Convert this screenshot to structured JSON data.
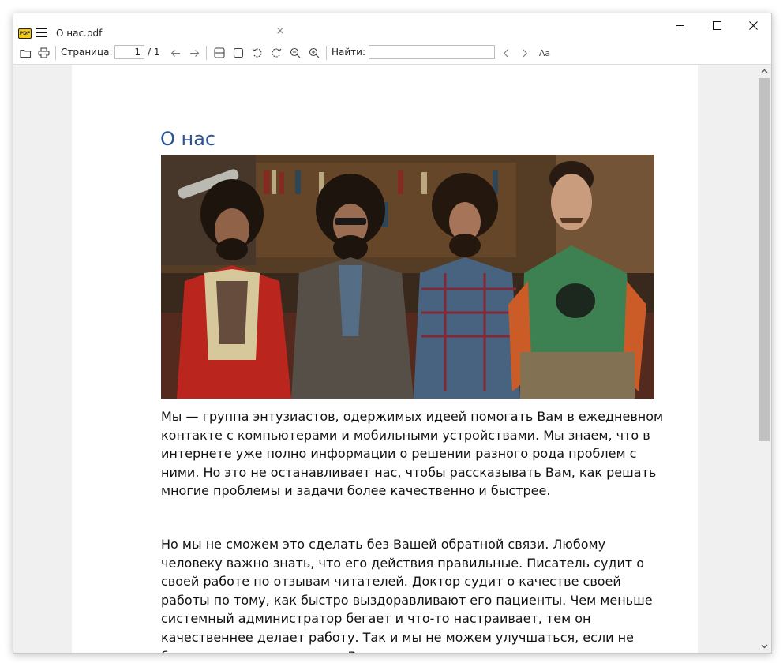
{
  "window": {
    "tab_title": "О нас.pdf",
    "tab_close": "×",
    "app_logo": "PDF"
  },
  "toolbar": {
    "page_label": "Страница:",
    "page_current": "1",
    "page_total": "/ 1",
    "find_label": "Найти:",
    "find_value": "",
    "match_case": "Aa"
  },
  "document": {
    "heading": "О нас",
    "paragraph1": "Мы — группа энтузиастов, одержимых идеей помогать Вам в ежедневном контакте с компьютерами и мобильными устройствами. Мы знаем, что в интернете уже полно информации о решении разного рода проблем с ними. Но это не останавливает нас, чтобы рассказывать Вам, как решать многие проблемы и задачи более качественно и быстрее.",
    "paragraph2": "Но мы не сможем это сделать без Вашей обратной связи. Любому человеку важно знать, что его действия правильные. Писатель судит о своей работе по отзывам читателей. Доктор судит о качестве своей работы по тому, как быстро выздоравливают его пациенты. Чем меньше системный администратор бегает и что-то настраивает, тем он качественнее делает работу. Так и мы не можем улучшаться, если не будем получать ответов от Вас.",
    "heading_color": "#2f5496"
  },
  "icons": {
    "open": "folder-icon",
    "print": "printer-icon",
    "prev": "arrow-left-icon",
    "next": "arrow-right-icon",
    "fit_width": "fit-width-icon",
    "fit_page": "fit-page-icon",
    "rotate_left": "rotate-left-icon",
    "rotate_right": "rotate-right-icon",
    "zoom_out": "zoom-out-icon",
    "zoom_in": "zoom-in-icon"
  }
}
